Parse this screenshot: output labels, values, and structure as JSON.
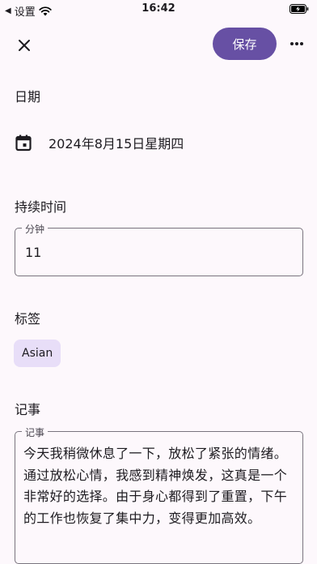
{
  "status_bar": {
    "carrier": "设置",
    "time": "16:42"
  },
  "app_bar": {
    "save_label": "保存",
    "close_icon": "close-icon",
    "more_icon": "more-horiz-icon"
  },
  "date_section": {
    "label": "日期",
    "value": "2024年8月15日星期四",
    "icon": "calendar-icon"
  },
  "duration_section": {
    "label": "持续时间",
    "field_label": "分钟",
    "value": "11"
  },
  "tags_section": {
    "label": "标签",
    "tags": [
      "Asian"
    ]
  },
  "notes_section": {
    "label": "记事",
    "field_label": "记事",
    "value": "今天我稍微休息了一下，放松了紧张的情绪。通过放松心情，我感到精神焕发，这真是一个非常好的选择。由于身心都得到了重置，下午的工作也恢复了集中力，变得更加高效。"
  },
  "colors": {
    "background": "#fdf8fc",
    "primary": "#6750a4",
    "chip_background": "#e8def8",
    "outline": "#79747e"
  }
}
